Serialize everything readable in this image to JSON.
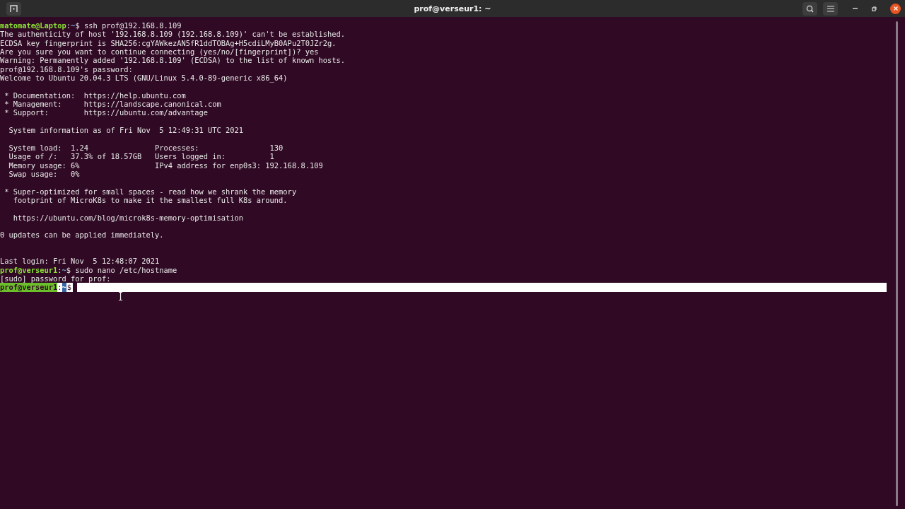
{
  "window": {
    "title": "prof@verseur1: ~"
  },
  "terminal": {
    "lines": [
      {
        "kind": "prompt",
        "user_host": "matomate@Laptop",
        "colon": ":",
        "path": "~",
        "dollar": "$",
        "command": " ssh prof@192.168.8.109",
        "selected": false
      },
      {
        "kind": "text",
        "text": "The authenticity of host '192.168.8.109 (192.168.8.109)' can't be established."
      },
      {
        "kind": "text",
        "text": "ECDSA key fingerprint is SHA256:cgYAWkezAN5fR1ddTOBAg+H5cdiLMyB0APu2T0JZr2g."
      },
      {
        "kind": "text",
        "text": "Are you sure you want to continue connecting (yes/no/[fingerprint])? yes"
      },
      {
        "kind": "text",
        "text": "Warning: Permanently added '192.168.8.109' (ECDSA) to the list of known hosts."
      },
      {
        "kind": "text",
        "text": "prof@192.168.8.109's password:"
      },
      {
        "kind": "text",
        "text": "Welcome to Ubuntu 20.04.3 LTS (GNU/Linux 5.4.0-89-generic x86_64)"
      },
      {
        "kind": "blank"
      },
      {
        "kind": "text",
        "text": " * Documentation:  https://help.ubuntu.com"
      },
      {
        "kind": "text",
        "text": " * Management:     https://landscape.canonical.com"
      },
      {
        "kind": "text",
        "text": " * Support:        https://ubuntu.com/advantage"
      },
      {
        "kind": "blank"
      },
      {
        "kind": "text",
        "text": "  System information as of Fri Nov  5 12:49:31 UTC 2021"
      },
      {
        "kind": "blank"
      },
      {
        "kind": "text",
        "text": "  System load:  1.24               Processes:                130"
      },
      {
        "kind": "text",
        "text": "  Usage of /:   37.3% of 18.57GB   Users logged in:          1"
      },
      {
        "kind": "text",
        "text": "  Memory usage: 6%                 IPv4 address for enp0s3: 192.168.8.109"
      },
      {
        "kind": "text",
        "text": "  Swap usage:   0%"
      },
      {
        "kind": "blank"
      },
      {
        "kind": "text",
        "text": " * Super-optimized for small spaces - read how we shrank the memory"
      },
      {
        "kind": "text",
        "text": "   footprint of MicroK8s to make it the smallest full K8s around."
      },
      {
        "kind": "blank"
      },
      {
        "kind": "text",
        "text": "   https://ubuntu.com/blog/microk8s-memory-optimisation"
      },
      {
        "kind": "blank"
      },
      {
        "kind": "text",
        "text": "0 updates can be applied immediately."
      },
      {
        "kind": "blank"
      },
      {
        "kind": "blank"
      },
      {
        "kind": "text",
        "text": "Last login: Fri Nov  5 12:48:07 2021"
      },
      {
        "kind": "prompt",
        "user_host": "prof@verseur1",
        "colon": ":",
        "path": "~",
        "dollar": "$",
        "command": " sudo nano /etc/hostname",
        "selected": false
      },
      {
        "kind": "text",
        "text": "[sudo] password for prof:"
      },
      {
        "kind": "prompt",
        "user_host": "prof@verseur1",
        "colon": ":",
        "path": "~",
        "dollar": "$",
        "selected": true
      }
    ]
  }
}
